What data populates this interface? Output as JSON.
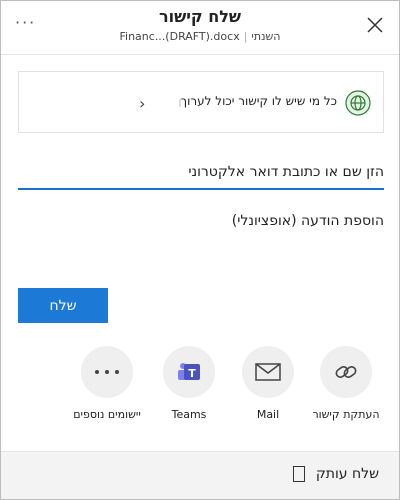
{
  "header": {
    "title": "שלח קישור",
    "file_name": "Financ...(DRAFT).docx",
    "owner": "השנתי",
    "more_label": "···"
  },
  "permission": {
    "text": "כל מי שיש לו קישור יכול לערוך",
    "chevron": "›"
  },
  "email": {
    "placeholder": "הזן שם או כתובת דואר אלקטרוני"
  },
  "message": {
    "placeholder": "הוספת הודעה (אופציונלי)"
  },
  "send_button": {
    "label": "שלח"
  },
  "share_options": [
    {
      "label": "העתקת קישור",
      "icon": "link-icon"
    },
    {
      "label": "Mail",
      "icon": "mail-icon"
    },
    {
      "label": "Teams",
      "icon": "teams-icon"
    },
    {
      "label": "יישומים נוספים",
      "icon": "more-apps-icon"
    }
  ],
  "footer": {
    "label": "שלח עותק",
    "icon": "copy-icon"
  },
  "colors": {
    "accent": "#1c7ad6",
    "globe": "#2e7d32",
    "teams": "#4b53bc"
  }
}
